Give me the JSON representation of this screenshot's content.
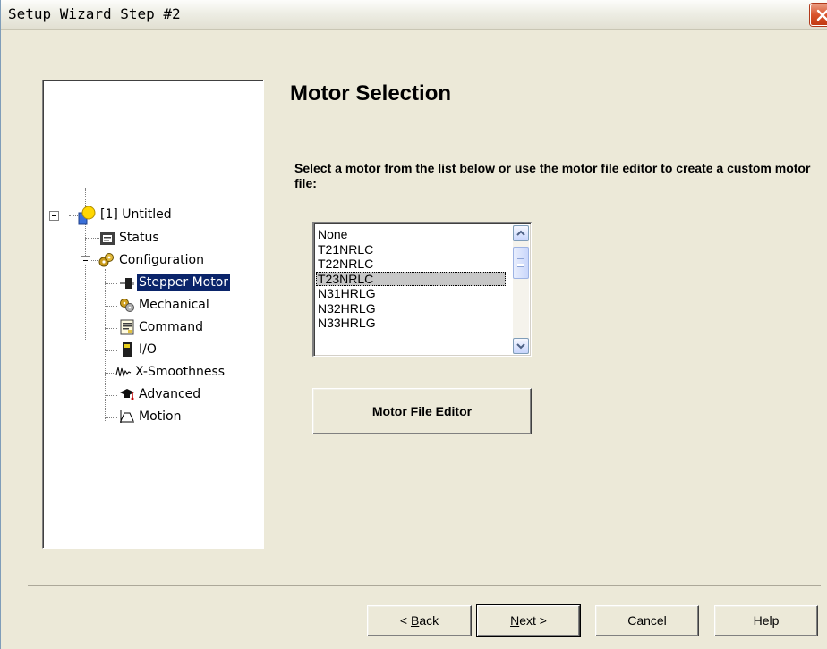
{
  "window": {
    "title": "Setup Wizard Step #2",
    "close_icon": "close-icon"
  },
  "tree": {
    "root": {
      "label": "[1] Untitled",
      "icon": "project-icon"
    },
    "items": [
      {
        "label": "Status",
        "icon": "status-icon"
      },
      {
        "label": "Configuration",
        "icon": "gears-icon"
      },
      {
        "label": "Stepper Motor",
        "icon": "motor-icon",
        "selected": true
      },
      {
        "label": "Mechanical",
        "icon": "mechanical-icon"
      },
      {
        "label": "Command",
        "icon": "command-icon"
      },
      {
        "label": "I/O",
        "icon": "io-icon"
      },
      {
        "label": "X-Smoothness",
        "icon": "smoothness-icon"
      },
      {
        "label": "Advanced",
        "icon": "advanced-icon"
      },
      {
        "label": "Motion",
        "icon": "motion-icon"
      }
    ]
  },
  "main": {
    "heading": "Motor Selection",
    "instructions": "Select a motor from the list below or use the motor file editor to create a custom motor file:",
    "motor_list": {
      "items": [
        "None",
        "T21NRLC",
        "T22NRLC",
        "T23NRLC",
        "N31HRLG",
        "N32HRLG",
        "N33HRLG"
      ],
      "selected": "T23NRLC"
    },
    "motor_file_editor": {
      "prefix": "M",
      "rest": "otor File Editor"
    }
  },
  "footer": {
    "back": {
      "pre": "< ",
      "ul": "B",
      "post": "ack"
    },
    "next": {
      "ul": "N",
      "post": "ext >"
    },
    "cancel": "Cancel",
    "help": "Help"
  },
  "colors": {
    "dialog_bg": "#ece9d8",
    "selection_bg": "#0a246a",
    "list_selection": "#c7c7c7"
  }
}
